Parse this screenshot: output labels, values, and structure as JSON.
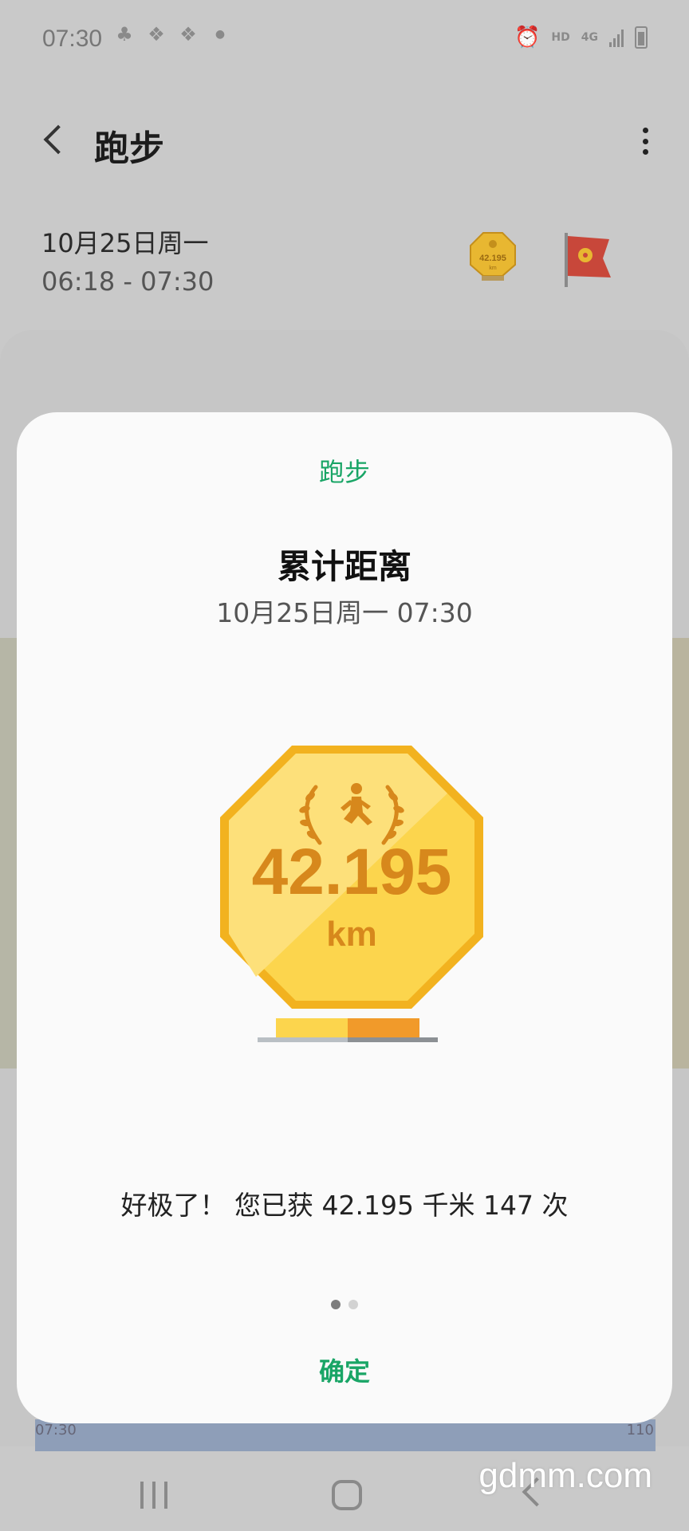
{
  "status_bar": {
    "time": "07:30",
    "network_hd": "HD",
    "network_4g": "4G"
  },
  "header": {
    "title": "跑步",
    "back_icon": "chevron-left-icon",
    "more_icon": "more-vertical-icon"
  },
  "session": {
    "date": "10月25日周一",
    "time_range": "06:18 - 07:30",
    "mini_badge_value": "42.195",
    "mini_badge_unit": "km"
  },
  "graph": {
    "start_label": "07:30",
    "end_label": "110"
  },
  "modal": {
    "category": "跑步",
    "title": "累计距离",
    "datetime": "10月25日周一 07:30",
    "badge": {
      "distance": "42.195",
      "unit": "km",
      "icon": "runner-laurel-icon"
    },
    "message": "好极了！ 您已获 42.195 千米 147 次",
    "pager": {
      "total": 2,
      "active": 1
    },
    "confirm_label": "确定"
  },
  "watermark": "gdmm.com",
  "colors": {
    "accent_green": "#19a566",
    "badge_gold": "#f5c02c",
    "badge_text": "#d7881c"
  }
}
